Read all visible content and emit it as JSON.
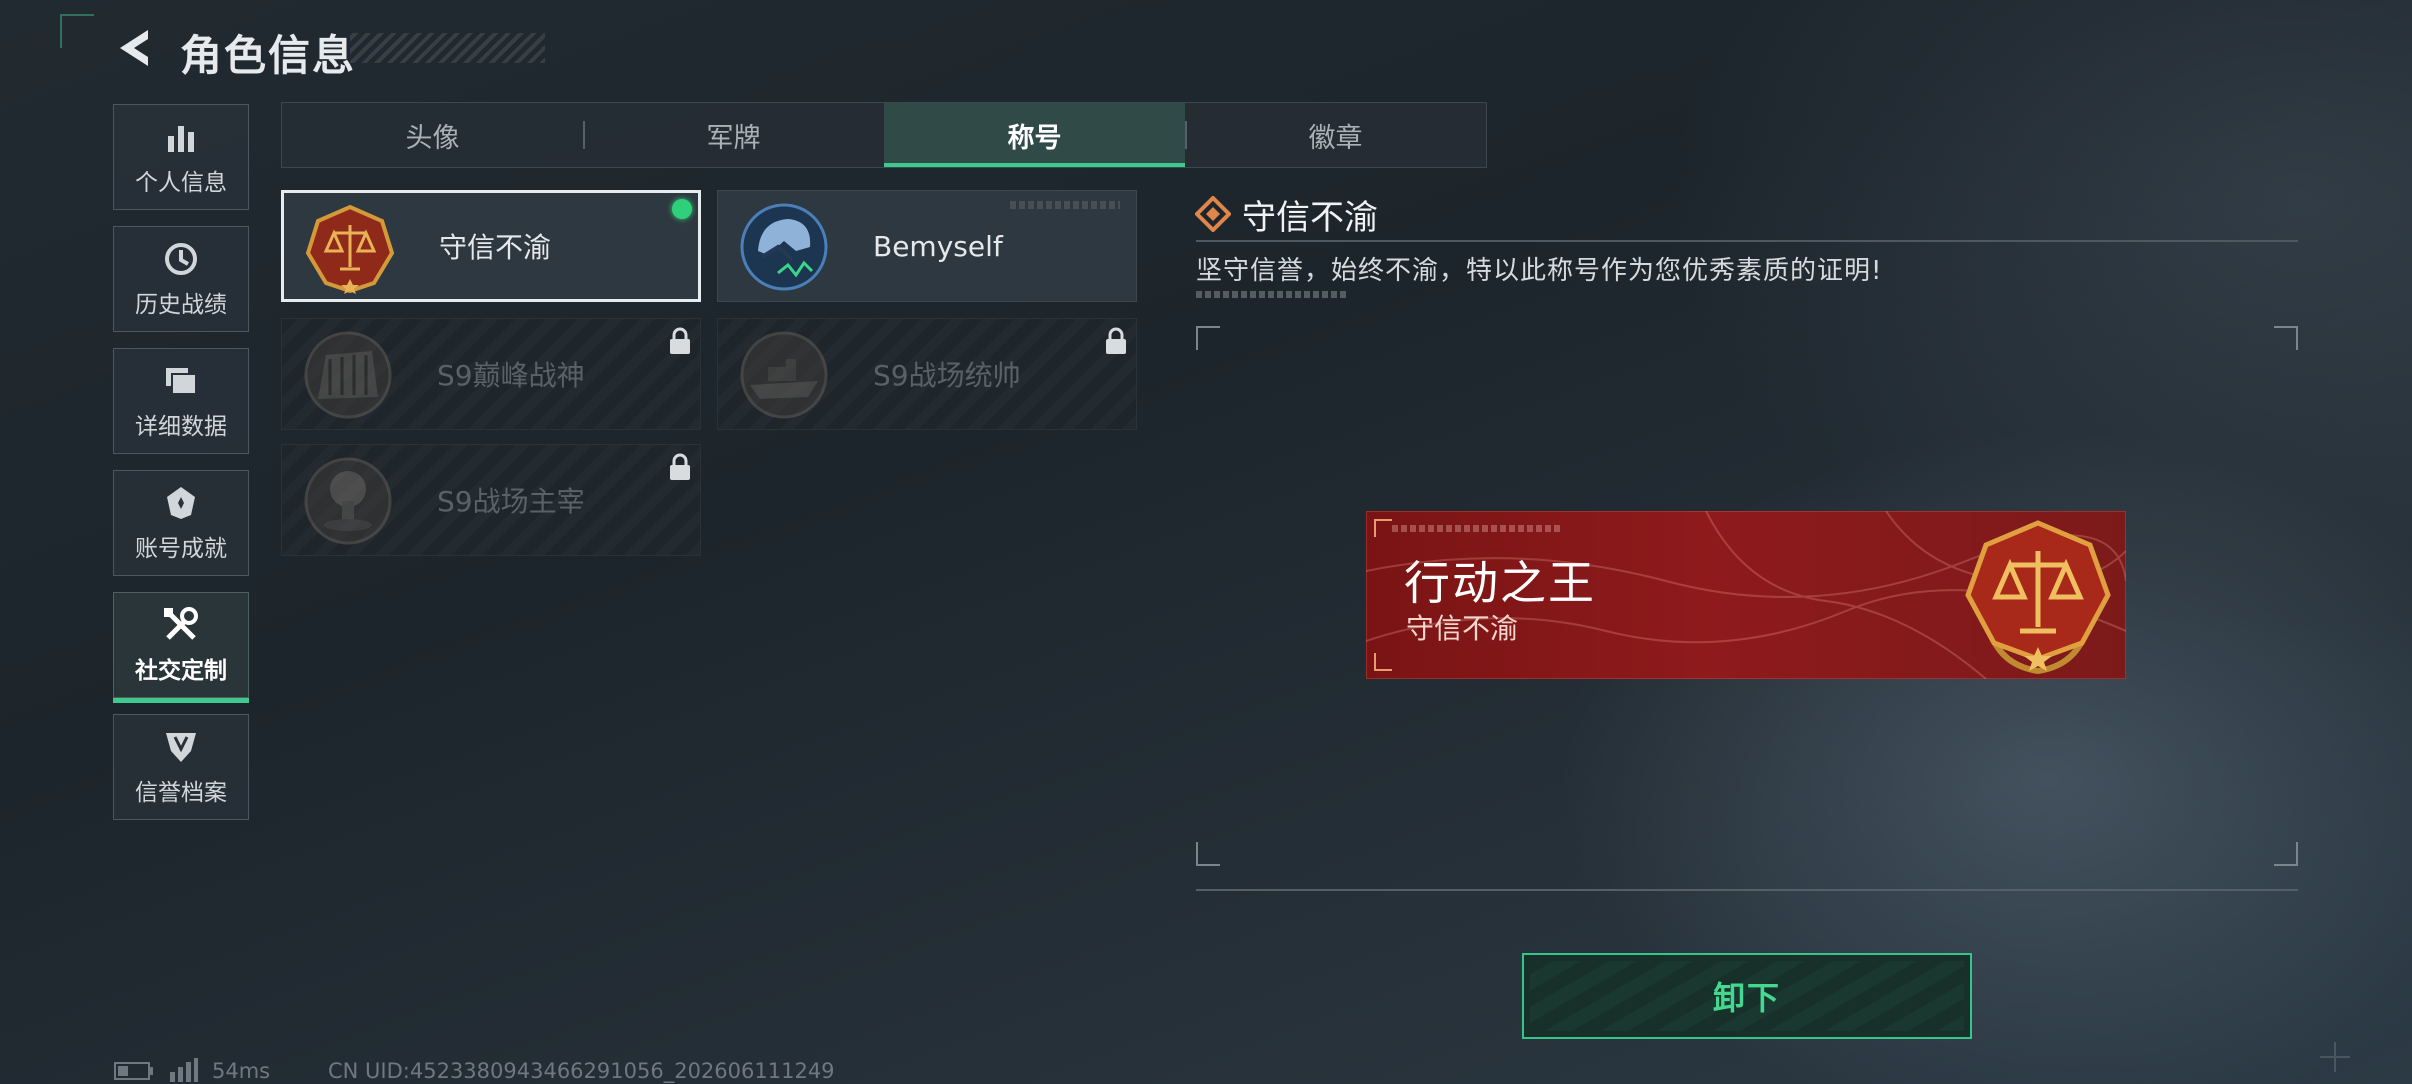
{
  "header": {
    "title": "角色信息"
  },
  "sidebar": {
    "items": [
      {
        "label": "个人信息",
        "icon": "stats-bars-icon",
        "active": false
      },
      {
        "label": "历史战绩",
        "icon": "history-clock-icon",
        "active": false
      },
      {
        "label": "详细数据",
        "icon": "folder-icon",
        "active": false
      },
      {
        "label": "账号成就",
        "icon": "achievement-icon",
        "active": false
      },
      {
        "label": "社交定制",
        "icon": "tools-icon",
        "active": true
      },
      {
        "label": "信誉档案",
        "icon": "credit-shield-icon",
        "active": false
      }
    ]
  },
  "tabs": [
    {
      "label": "头像",
      "active": false
    },
    {
      "label": "军牌",
      "active": false
    },
    {
      "label": "称号",
      "active": true
    },
    {
      "label": "徽章",
      "active": false
    }
  ],
  "titles": [
    {
      "name": "守信不渝",
      "locked": false,
      "selected": true,
      "equipped": true,
      "icon": "scales-medal-icon"
    },
    {
      "name": "Bemyself",
      "locked": false,
      "selected": false,
      "equipped": false,
      "icon": "helmet-medal-icon"
    },
    {
      "name": "S9巅峰战神",
      "locked": true,
      "selected": false,
      "equipped": false,
      "icon": "fortress-medal-icon"
    },
    {
      "name": "S9战场统帅",
      "locked": true,
      "selected": false,
      "equipped": false,
      "icon": "warship-medal-icon"
    },
    {
      "name": "S9战场主宰",
      "locked": true,
      "selected": false,
      "equipped": false,
      "icon": "explosion-medal-icon"
    }
  ],
  "detail": {
    "title": "守信不渝",
    "description": "坚守信誉，始终不渝，特以此称号作为您优秀素质的证明!"
  },
  "preview": {
    "player_name": "行动之王",
    "title_text": "守信不渝"
  },
  "actions": {
    "unequip_label": "卸下"
  },
  "status": {
    "ping": "54ms",
    "uid": "CN UID:4523380943466291056_202606111249"
  },
  "colors": {
    "accent": "#3ec98d",
    "banner_red": "#8e1a1c",
    "medal_gold": "#d49a3a"
  }
}
